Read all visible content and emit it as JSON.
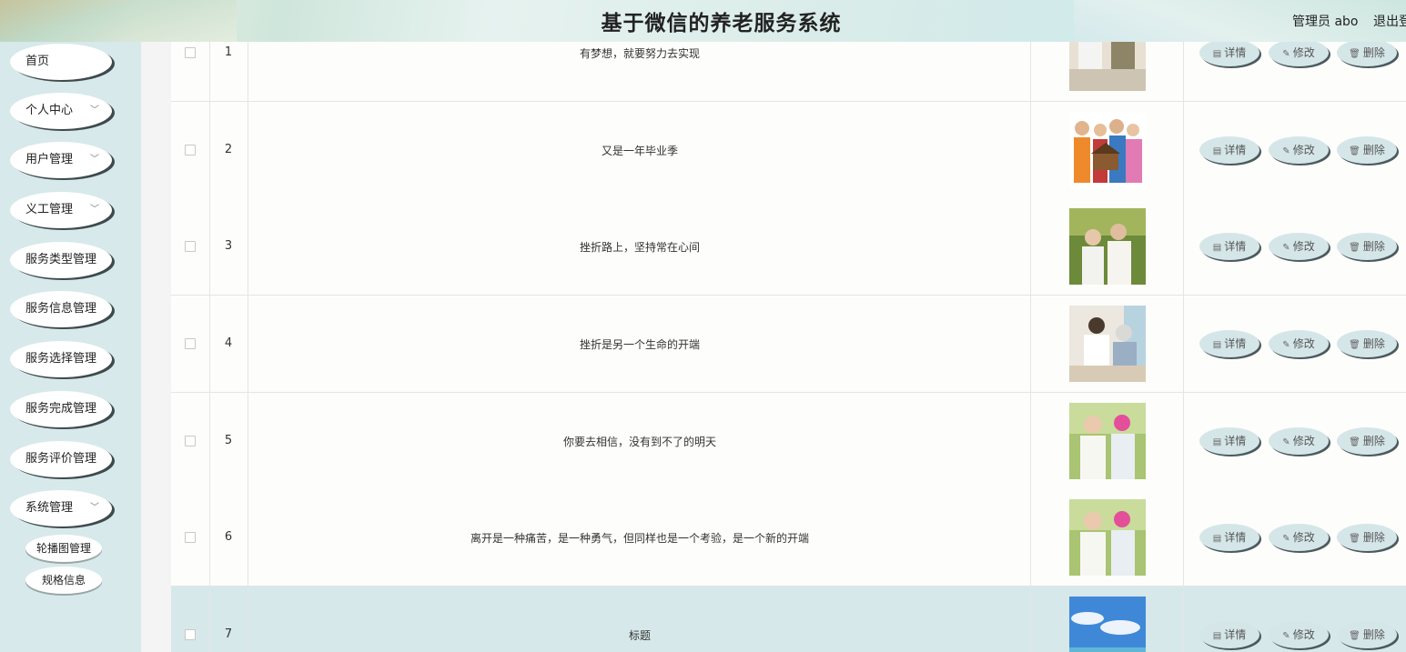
{
  "header": {
    "title": "基于微信的养老服务系统",
    "user": "管理员 abo",
    "logout": "退出登"
  },
  "sidebar": {
    "items": [
      {
        "label": "首页",
        "has_chevron": false
      },
      {
        "label": "个人中心",
        "has_chevron": true
      },
      {
        "label": "用户管理",
        "has_chevron": true
      },
      {
        "label": "义工管理",
        "has_chevron": true
      },
      {
        "label": "服务类型管理",
        "has_chevron": false
      },
      {
        "label": "服务信息管理",
        "has_chevron": false
      },
      {
        "label": "服务选择管理",
        "has_chevron": false
      },
      {
        "label": "服务完成管理",
        "has_chevron": false
      },
      {
        "label": "服务评价管理",
        "has_chevron": false
      },
      {
        "label": "系统管理",
        "has_chevron": true
      }
    ],
    "sub_items": [
      {
        "label": "轮播图管理"
      },
      {
        "label": "规格信息"
      }
    ]
  },
  "table": {
    "actions": {
      "detail": "详情",
      "edit": "修改",
      "delete": "删除"
    },
    "rows": [
      {
        "index": "1",
        "title": "有梦想，就要努力去实现",
        "image": "elderly-care-photo"
      },
      {
        "index": "2",
        "title": "又是一年毕业季",
        "image": "elderly-group-photo"
      },
      {
        "index": "3",
        "title": "挫折路上，坚持常在心间",
        "image": "elderly-couple-forest-photo"
      },
      {
        "index": "4",
        "title": "挫折是另一个生命的开端",
        "image": "blood-pressure-check-photo"
      },
      {
        "index": "5",
        "title": "你要去相信，没有到不了的明天",
        "image": "elderly-couple-park-photo"
      },
      {
        "index": "6",
        "title": "离开是一种痛苦，是一种勇气，但同样也是一个考验，是一个新的开端",
        "image": "elderly-couple-park-photo"
      },
      {
        "index": "7",
        "title": "标题",
        "image": "beach-sky-photo"
      }
    ]
  },
  "colors": {
    "sidebar_bg": "#d7e9ea",
    "button_bg": "#d5e6e8",
    "highlight_row": "#d6e8ea"
  }
}
